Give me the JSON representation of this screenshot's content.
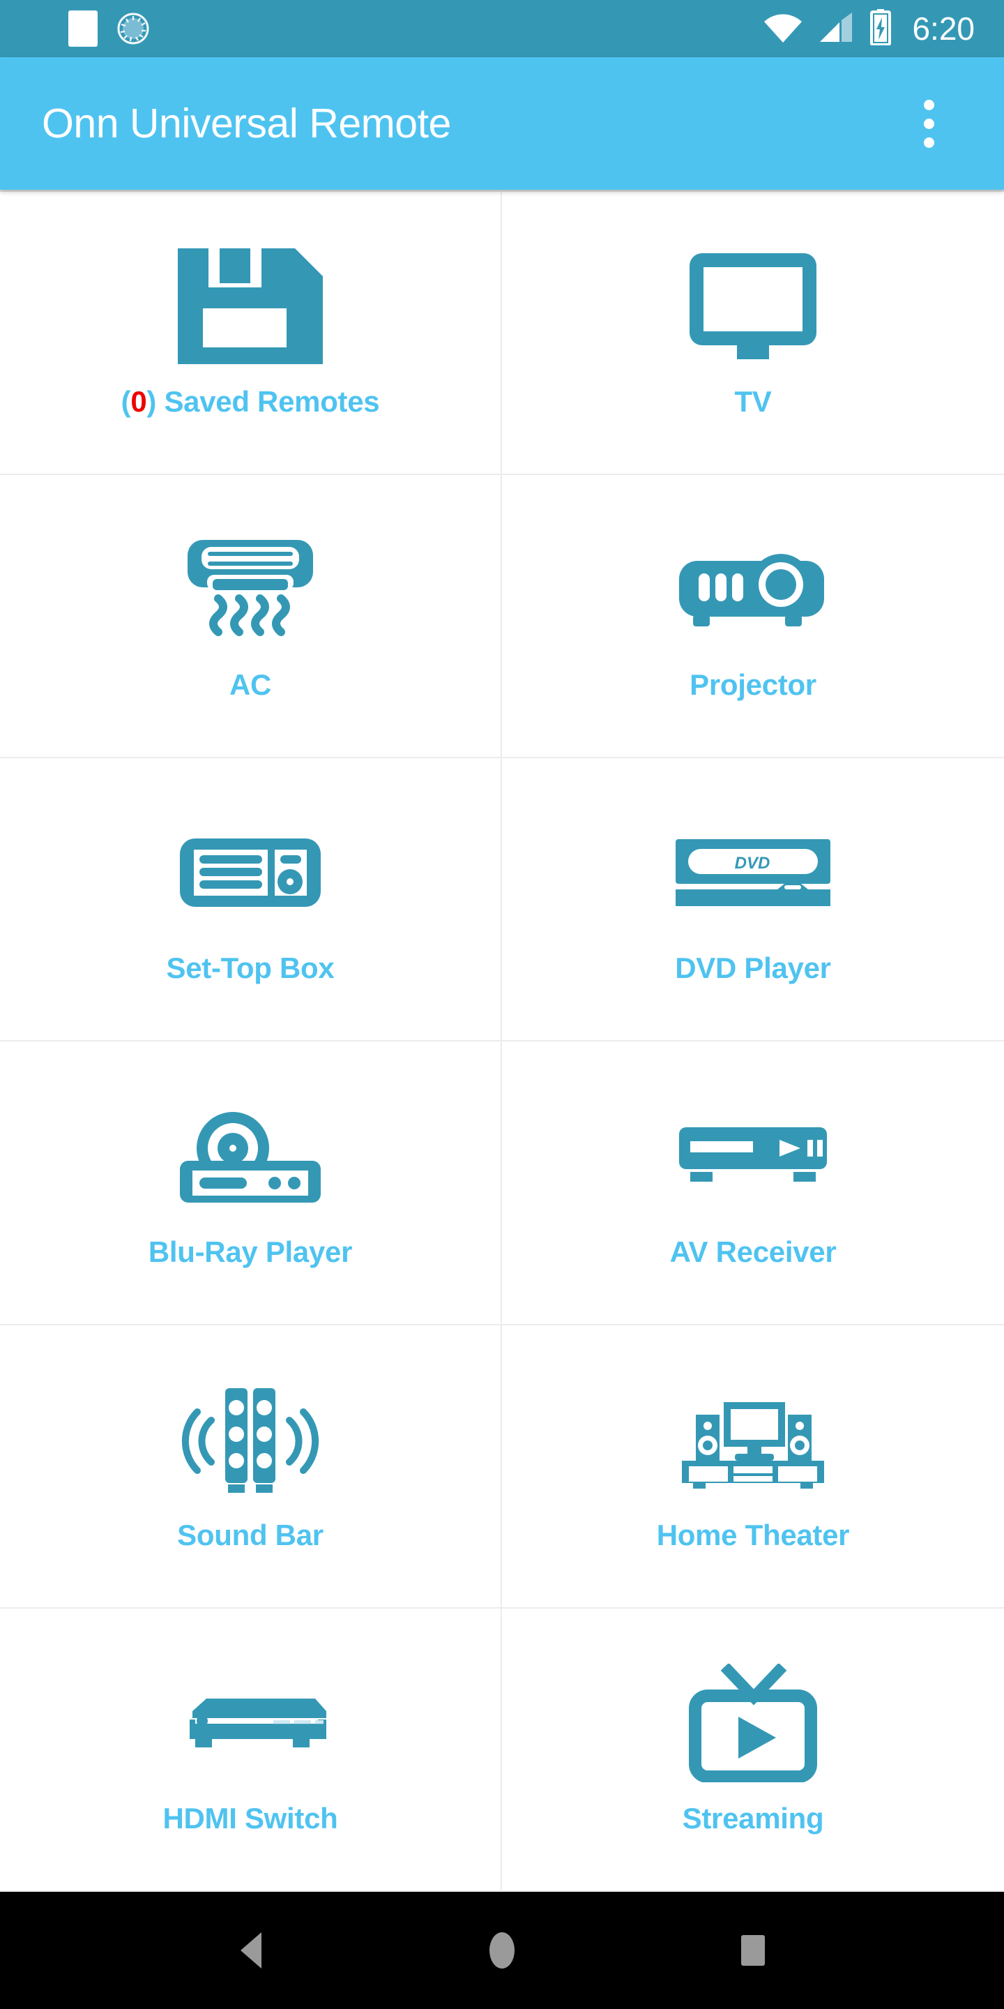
{
  "status_bar": {
    "time": "6:20",
    "icons": [
      "notification-square-icon",
      "sync-spinner-icon",
      "wifi-icon",
      "cellular-signal-icon",
      "battery-charging-icon"
    ],
    "background_color": "#3498B5"
  },
  "app_bar": {
    "title": "Onn Universal Remote",
    "overflow_label": "More options",
    "background_color": "#4FC3F0",
    "title_color": "#FFFFFF"
  },
  "colors": {
    "icon_teal": "#3498B5",
    "label_blue": "#4FC3F0",
    "count_red": "#EE0000",
    "divider": "#ECECEC",
    "cell_bg": "#FFFFFF",
    "nav_bg": "#000000",
    "nav_icon": "#9A9A9A"
  },
  "grid": {
    "cells": [
      {
        "id": "saved-remotes",
        "icon": "floppy-disk-save-icon",
        "label_prefix": "(",
        "count": "0",
        "label_suffix": ") Saved Remotes",
        "label": "(0) Saved Remotes"
      },
      {
        "id": "tv",
        "icon": "tv-monitor-icon",
        "label": "TV"
      },
      {
        "id": "ac",
        "icon": "air-conditioner-icon",
        "label": "AC"
      },
      {
        "id": "projector",
        "icon": "projector-icon",
        "label": "Projector"
      },
      {
        "id": "set-top-box",
        "icon": "set-top-box-icon",
        "label": "Set-Top Box"
      },
      {
        "id": "dvd-player",
        "icon": "dvd-player-icon",
        "label": "DVD Player",
        "icon_text": "DVD"
      },
      {
        "id": "blu-ray-player",
        "icon": "blu-ray-player-icon",
        "label": "Blu-Ray Player"
      },
      {
        "id": "av-receiver",
        "icon": "av-receiver-icon",
        "label": "AV Receiver"
      },
      {
        "id": "sound-bar",
        "icon": "sound-bar-speakers-icon",
        "label": "Sound Bar"
      },
      {
        "id": "home-theater",
        "icon": "home-theater-icon",
        "label": "Home Theater"
      },
      {
        "id": "hdmi-switch",
        "icon": "hdmi-switch-icon",
        "label": "HDMI Switch"
      },
      {
        "id": "streaming",
        "icon": "streaming-tv-play-icon",
        "label": "Streaming"
      }
    ]
  },
  "nav_bar": {
    "back_label": "Back",
    "home_label": "Home",
    "recents_label": "Recents"
  }
}
